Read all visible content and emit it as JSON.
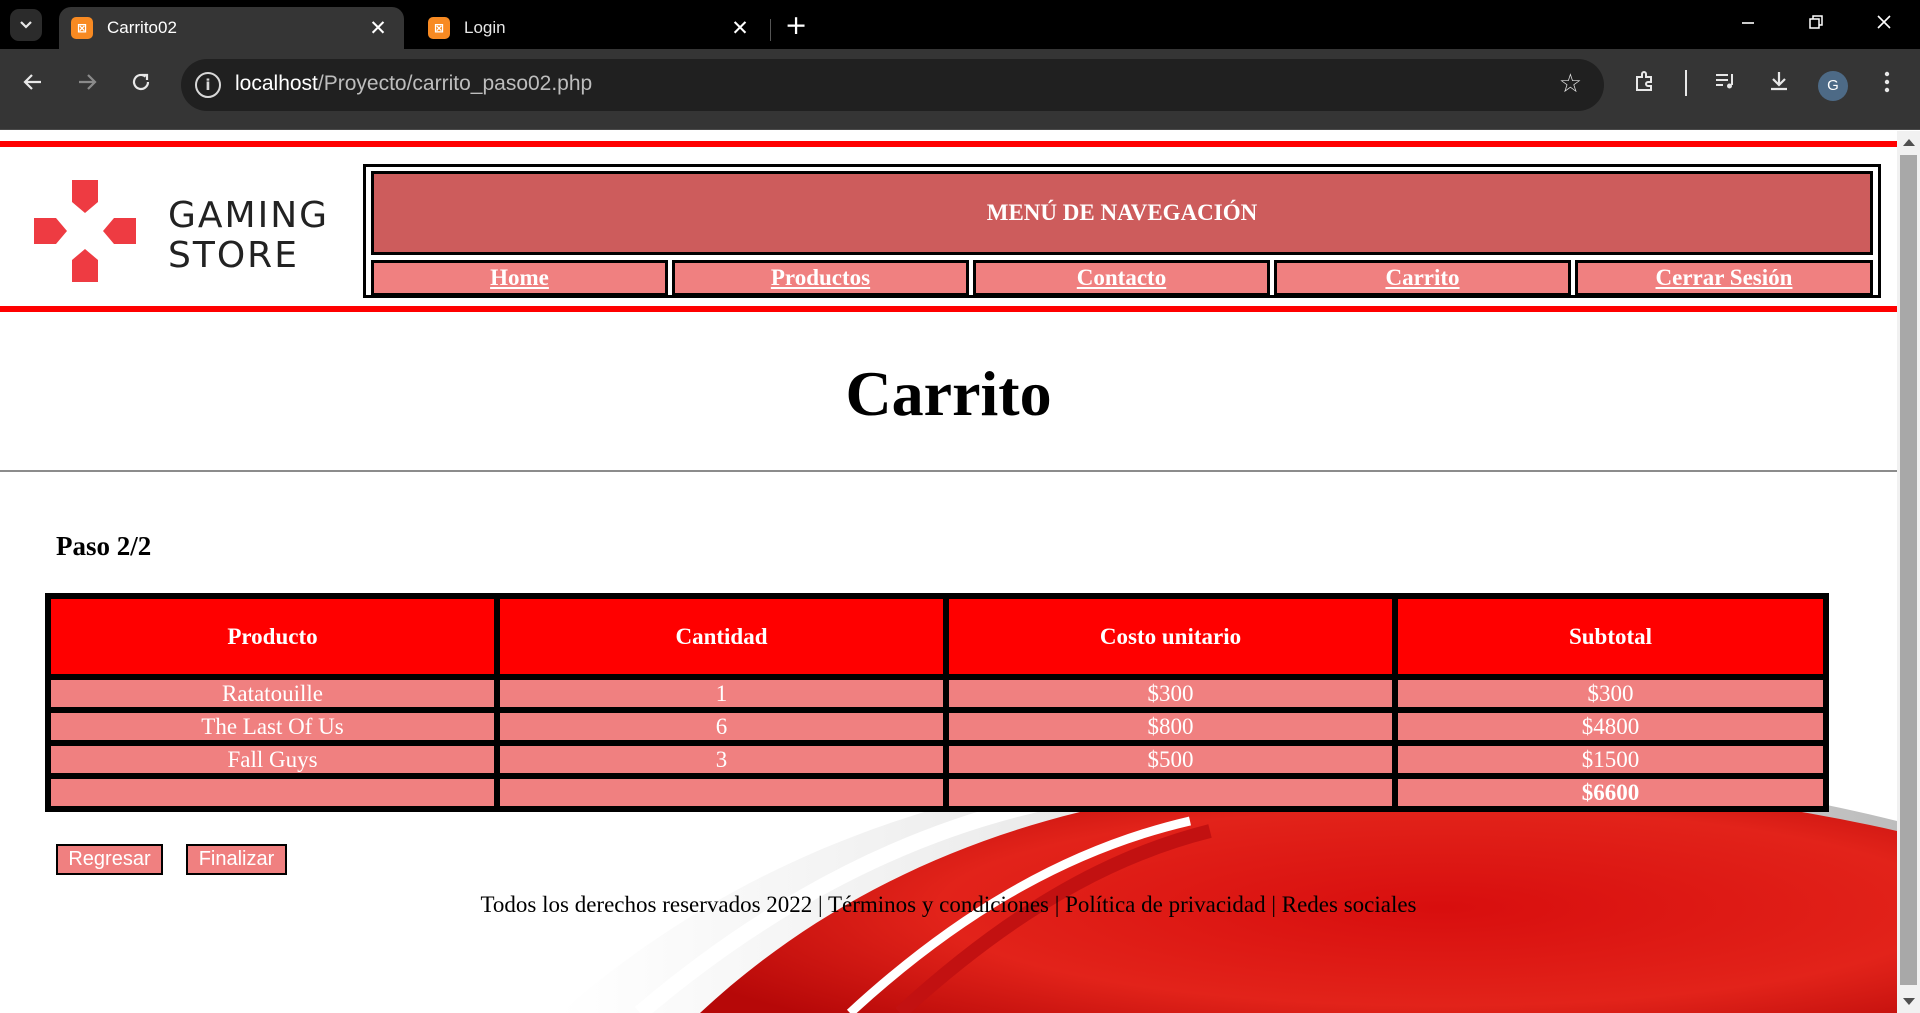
{
  "browser": {
    "tabs": [
      {
        "title": "Carrito02",
        "active": true,
        "favicon": "xampp-icon"
      },
      {
        "title": "Login",
        "active": false,
        "favicon": "xampp-icon"
      }
    ],
    "url_host": "localhost",
    "url_path": "/Proyecto/carrito_paso02.php",
    "profile_initial": "G"
  },
  "brand": {
    "line1": "GAMING",
    "line2": "STORE",
    "accent": "#ee3b42"
  },
  "nav": {
    "title": "MENÚ DE NAVEGACIÓN",
    "items": [
      "Home",
      "Productos",
      "Contacto",
      "Carrito",
      "Cerrar Sesión"
    ]
  },
  "page": {
    "title": "Carrito",
    "step": "Paso 2/2"
  },
  "cart": {
    "headers": [
      "Producto",
      "Cantidad",
      "Costo unitario",
      "Subtotal"
    ],
    "rows": [
      [
        "Ratatouille",
        "1",
        "$300",
        "$300"
      ],
      [
        "The Last Of Us",
        "6",
        "$800",
        "$4800"
      ],
      [
        "Fall Guys",
        "3",
        "$500",
        "$1500"
      ]
    ],
    "total": "$6600"
  },
  "buttons": {
    "back": "Regresar",
    "finish": "Finalizar"
  },
  "footer": {
    "text": "Todos los derechos reservados 2022 | Términos y condiciones | Política de privacidad | Redes sociales"
  },
  "colors": {
    "header_red": "#ff0000",
    "nav_title_bg": "#cd5c5c",
    "light_coral": "#f08080",
    "table_head": "#ff0000"
  }
}
